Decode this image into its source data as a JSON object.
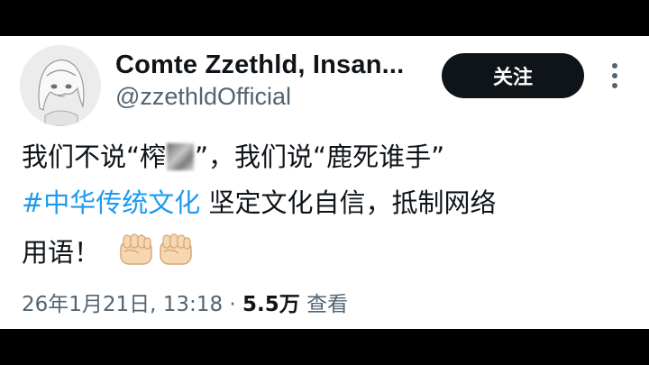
{
  "author": {
    "display_name": "Comte Zzethld, Insan...",
    "handle": "@zzethldOfficial"
  },
  "follow_button_label": "关注",
  "tweet": {
    "line1_part1": "我们不说“榨",
    "line1_part2": "”，我们说“鹿死谁手”",
    "hashtag": "#中华传统文化",
    "line2_rest": " 坚定文化自信，抵制网络",
    "line3_text": "用语！"
  },
  "meta": {
    "timestamp": "26年1月21日, 13:18",
    "separator": "·",
    "views_count": "5.5万",
    "views_label": "查看"
  },
  "icons": {
    "more": "more-vertical-icon",
    "fist": "raised-fist-emoji"
  },
  "colors": {
    "link": "#1d9bf0",
    "text": "#0f1419",
    "secondary": "#536471",
    "button_bg": "#0f1419"
  }
}
